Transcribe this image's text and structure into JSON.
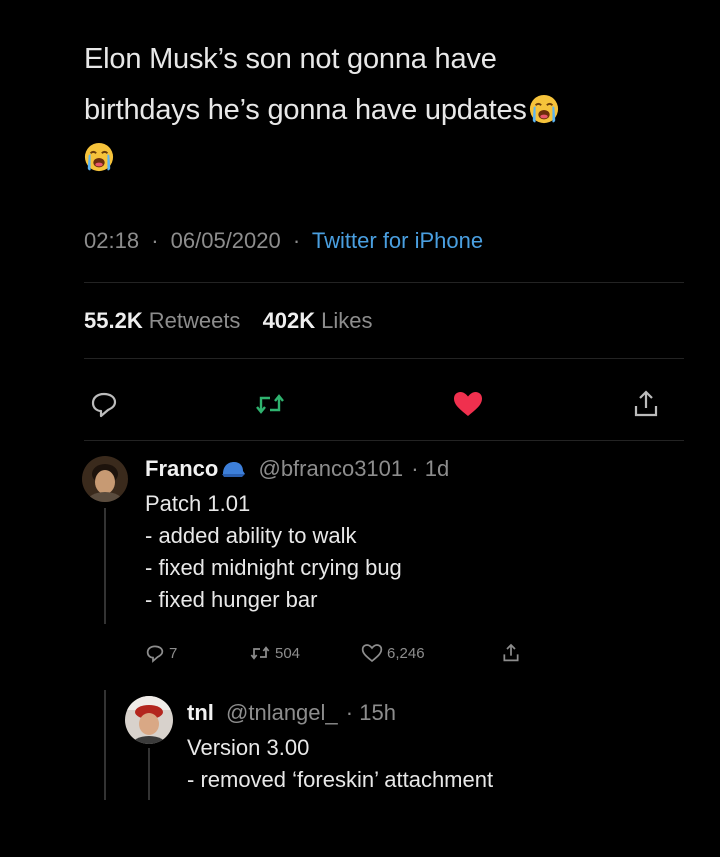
{
  "tweet": {
    "line1": "Elon Musk’s son not gonna have",
    "line2": "birthdays he’s gonna have updates",
    "emoji_icon": "loudly-crying-face-icon",
    "time": "02:18",
    "separator": "·",
    "date": "06/05/2020",
    "source": "Twitter for iPhone",
    "retweets_count": "55.2K",
    "retweets_label": "Retweets",
    "likes_count": "402K",
    "likes_label": "Likes"
  },
  "actions": [
    {
      "icon": "reply-icon"
    },
    {
      "icon": "retweet-icon",
      "color": "#2fb36f"
    },
    {
      "icon": "heart-icon",
      "color": "#f0304e"
    },
    {
      "icon": "share-icon"
    }
  ],
  "reply1": {
    "name": "Franco",
    "badge_icon": "cap-emoji-icon",
    "handle": "@bfranco3101",
    "time": "· 1d",
    "lines": [
      "Patch 1.01",
      "- added ability to walk",
      "- fixed midnight crying bug",
      "- fixed hunger bar"
    ],
    "reply_count": "7",
    "retweet_count": "504",
    "like_count": "6,246"
  },
  "reply2": {
    "name": "tnl",
    "handle": "@tnlangel_",
    "time": "· 15h",
    "lines": [
      "Version 3.00",
      "- removed ‘foreskin’ attachment"
    ]
  },
  "colors": {
    "background": "#000000",
    "link": "#4a9fe0",
    "retweet": "#2fb36f",
    "like": "#f0304e",
    "muted": "#8d8d8d"
  }
}
